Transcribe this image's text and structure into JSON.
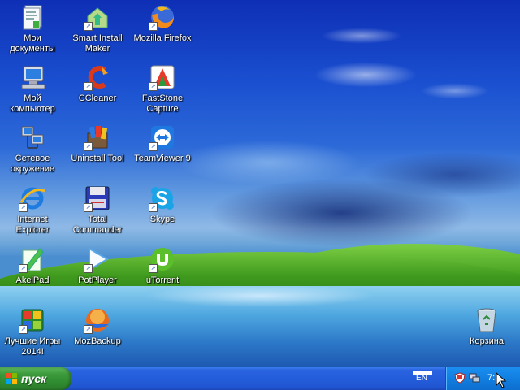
{
  "desktop": {
    "icons": [
      {
        "label": "Мои\nдокументы",
        "icon": "my-documents-icon"
      },
      {
        "label": "Smart Install\nMaker",
        "icon": "smart-install-maker-icon"
      },
      {
        "label": "Mozilla Firefox",
        "icon": "firefox-icon"
      },
      {
        "label": "Мой\nкомпьютер",
        "icon": "my-computer-icon"
      },
      {
        "label": "CCleaner",
        "icon": "ccleaner-icon"
      },
      {
        "label": "FastStone\nCapture",
        "icon": "faststone-capture-icon"
      },
      {
        "label": "Сетевое\nокружение",
        "icon": "network-places-icon"
      },
      {
        "label": "Uninstall Tool",
        "icon": "uninstall-tool-icon"
      },
      {
        "label": "TeamViewer 9",
        "icon": "teamviewer-icon"
      },
      {
        "label": "Internet\nExplorer",
        "icon": "internet-explorer-icon"
      },
      {
        "label": "Total\nCommander",
        "icon": "total-commander-icon"
      },
      {
        "label": "Skype",
        "icon": "skype-icon"
      },
      {
        "label": "AkelPad",
        "icon": "akelpad-icon"
      },
      {
        "label": "PotPlayer",
        "icon": "potplayer-icon"
      },
      {
        "label": "uTorrent",
        "icon": "utorrent-icon"
      },
      {
        "label": "Лучшие Игры\n2014!",
        "icon": "best-games-icon"
      },
      {
        "label": "MozBackup",
        "icon": "mozbackup-icon"
      },
      {
        "label": "Корзина",
        "icon": "recycle-bin-icon"
      }
    ]
  },
  "taskbar": {
    "start_label": "пуск",
    "language": "EN",
    "clock": "7:"
  },
  "colors": {
    "taskbar": "#245ddb",
    "start_button": "#3c9a3c",
    "tray": "#117fe0"
  }
}
